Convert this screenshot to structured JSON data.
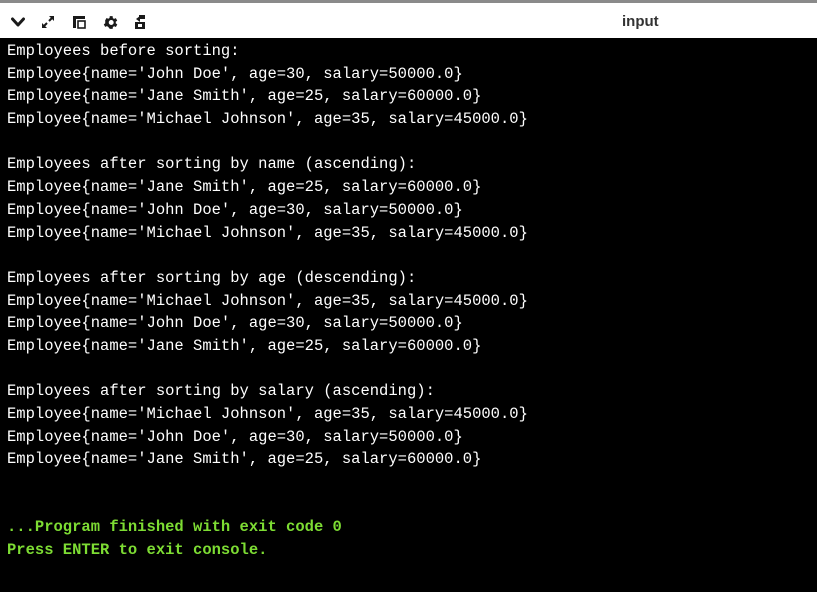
{
  "toolbar": {
    "icons": [
      {
        "name": "chevron-down-icon"
      },
      {
        "name": "expand-icon"
      },
      {
        "name": "split-panel-icon"
      },
      {
        "name": "gear-icon"
      },
      {
        "name": "share-icon"
      }
    ],
    "tab_label": "input"
  },
  "console": {
    "lines": [
      {
        "text": "Employees before sorting:",
        "color": "#ffffff"
      },
      {
        "text": "Employee{name='John Doe', age=30, salary=50000.0}",
        "color": "#ffffff"
      },
      {
        "text": "Employee{name='Jane Smith', age=25, salary=60000.0}",
        "color": "#ffffff"
      },
      {
        "text": "Employee{name='Michael Johnson', age=35, salary=45000.0}",
        "color": "#ffffff"
      },
      {
        "text": "",
        "color": "#ffffff"
      },
      {
        "text": "Employees after sorting by name (ascending):",
        "color": "#ffffff"
      },
      {
        "text": "Employee{name='Jane Smith', age=25, salary=60000.0}",
        "color": "#ffffff"
      },
      {
        "text": "Employee{name='John Doe', age=30, salary=50000.0}",
        "color": "#ffffff"
      },
      {
        "text": "Employee{name='Michael Johnson', age=35, salary=45000.0}",
        "color": "#ffffff"
      },
      {
        "text": "",
        "color": "#ffffff"
      },
      {
        "text": "Employees after sorting by age (descending):",
        "color": "#ffffff"
      },
      {
        "text": "Employee{name='Michael Johnson', age=35, salary=45000.0}",
        "color": "#ffffff"
      },
      {
        "text": "Employee{name='John Doe', age=30, salary=50000.0}",
        "color": "#ffffff"
      },
      {
        "text": "Employee{name='Jane Smith', age=25, salary=60000.0}",
        "color": "#ffffff"
      },
      {
        "text": "",
        "color": "#ffffff"
      },
      {
        "text": "Employees after sorting by salary (ascending):",
        "color": "#ffffff"
      },
      {
        "text": "Employee{name='Michael Johnson', age=35, salary=45000.0}",
        "color": "#ffffff"
      },
      {
        "text": "Employee{name='John Doe', age=30, salary=50000.0}",
        "color": "#ffffff"
      },
      {
        "text": "Employee{name='Jane Smith', age=25, salary=60000.0}",
        "color": "#ffffff"
      },
      {
        "text": "",
        "color": "#ffffff"
      },
      {
        "text": "",
        "color": "#ffffff"
      },
      {
        "text": "...Program finished with exit code 0",
        "color": "#7ddc33"
      },
      {
        "text": "Press ENTER to exit console.",
        "color": "#7ddc33"
      }
    ]
  },
  "colors": {
    "console_background": "#000000",
    "console_text": "#ffffff",
    "status_text": "#7ddc33",
    "toolbar_background": "#ffffff"
  }
}
